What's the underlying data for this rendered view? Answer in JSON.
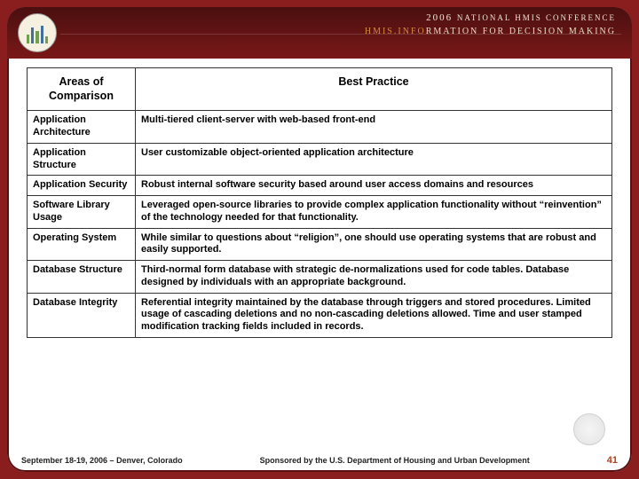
{
  "header": {
    "line1_year": "2006",
    "line1_text": "NATIONAL HMIS CONFERENCE",
    "line2_accent": "HMIS.INFO",
    "line2_rest": "RMATION FOR DECISION MAKING"
  },
  "table": {
    "col1": "Areas of Comparison",
    "col2": "Best Practice",
    "rows": [
      {
        "area": "Application Architecture",
        "bp": "Multi-tiered client-server with web-based front-end"
      },
      {
        "area": "Application Structure",
        "bp": "User customizable object-oriented application architecture"
      },
      {
        "area": "Application Security",
        "bp": "Robust internal software security based around user access domains and resources"
      },
      {
        "area": "Software Library Usage",
        "bp": "Leveraged open-source libraries to provide complex application functionality without “reinvention” of the technology needed for that functionality."
      },
      {
        "area": "Operating System",
        "bp": "While similar to questions about “religion”, one should use operating systems that are robust and easily supported."
      },
      {
        "area": "Database Structure",
        "bp": "Third-normal form database with strategic de-normalizations used for code tables. Database designed by individuals with an appropriate background."
      },
      {
        "area": "Database Integrity",
        "bp": "Referential integrity maintained by the database through triggers and stored procedures. Limited usage of cascading deletions and no non-cascading deletions allowed. Time and user stamped modification tracking fields included in records."
      }
    ]
  },
  "footer": {
    "left": "September 18-19, 2006 – Denver, Colorado",
    "mid": "Sponsored by the U.S. Department of Housing and Urban Development",
    "page": "41"
  }
}
